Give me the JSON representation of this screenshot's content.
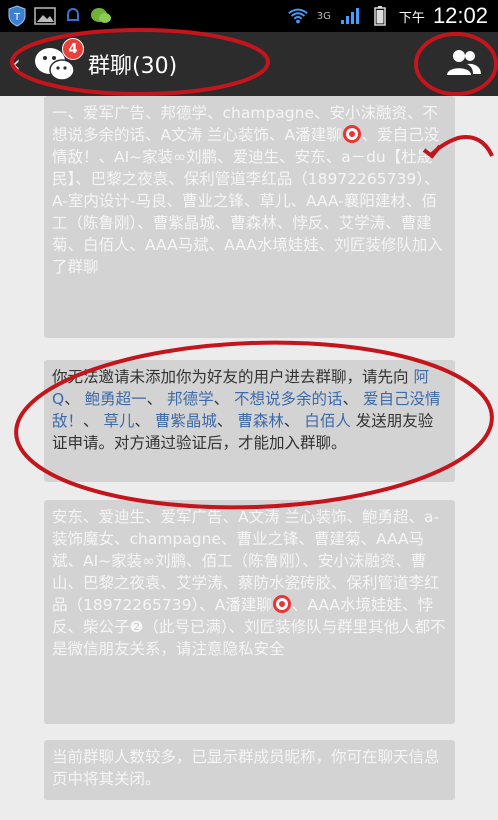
{
  "status_bar": {
    "signal_label": "3G",
    "ampm": "下午",
    "time": "12:02"
  },
  "header": {
    "badge": "4",
    "title": "群聊(30)"
  },
  "messages": {
    "m1": "一、爱军广告、邦德学、champagne、安小沫融资、不想说多余的话、A文涛 兰心装饰、A潘建聊",
    "m1b": "、爱自己没情敌！、AI~家装∞刘鹏、爱迪生、安东、a－du【杜晟民】、巴黎之夜袁、保利管道李红品（18972265739）、A-室内设计-马良、曹业之锋、草儿、AAA-襄阳建材、佰工（陈鲁刚）、曹紫晶城、曹森林、悖反、艾学涛、曹建菊、白佰人、AAA马斌、AAA水境娃娃、刘匠装修队加入了群聊",
    "m2_pre": "你无法邀请未添加你为好友的用户进去群聊，请先向 ",
    "m2_names": [
      "阿Q",
      "鲍勇超一",
      "邦德学",
      "不想说多余的话",
      "爱自己没情敌！",
      "草儿",
      "曹紫晶城",
      "曹森林",
      "白佰人"
    ],
    "m2_post": " 发送朋友验证申请。对方通过验证后，才能加入群聊。",
    "m3": "安东、爱迪生、爱军广告、A文涛 兰心装饰、鲍勇超、a-装饰魔女、champagne、曹业之锋、曹建菊、AAA马斌、AI~家装∞刘鹏、佰工（陈鲁刚）、安小沫融资、曹山、巴黎之夜袁、艾学涛、蔡防水瓷砖胶、保利管道李红品（18972265739）、A潘建聊",
    "m3b": "、AAA水境娃娃、悖反、柴公子❷（此号已满）、刘匠装修队与群里其他人都不是微信朋友关系，请注意隐私安全",
    "m4": "当前群聊人数较多，已显示群成员昵称，你可在聊天信息页中将其关闭。"
  }
}
